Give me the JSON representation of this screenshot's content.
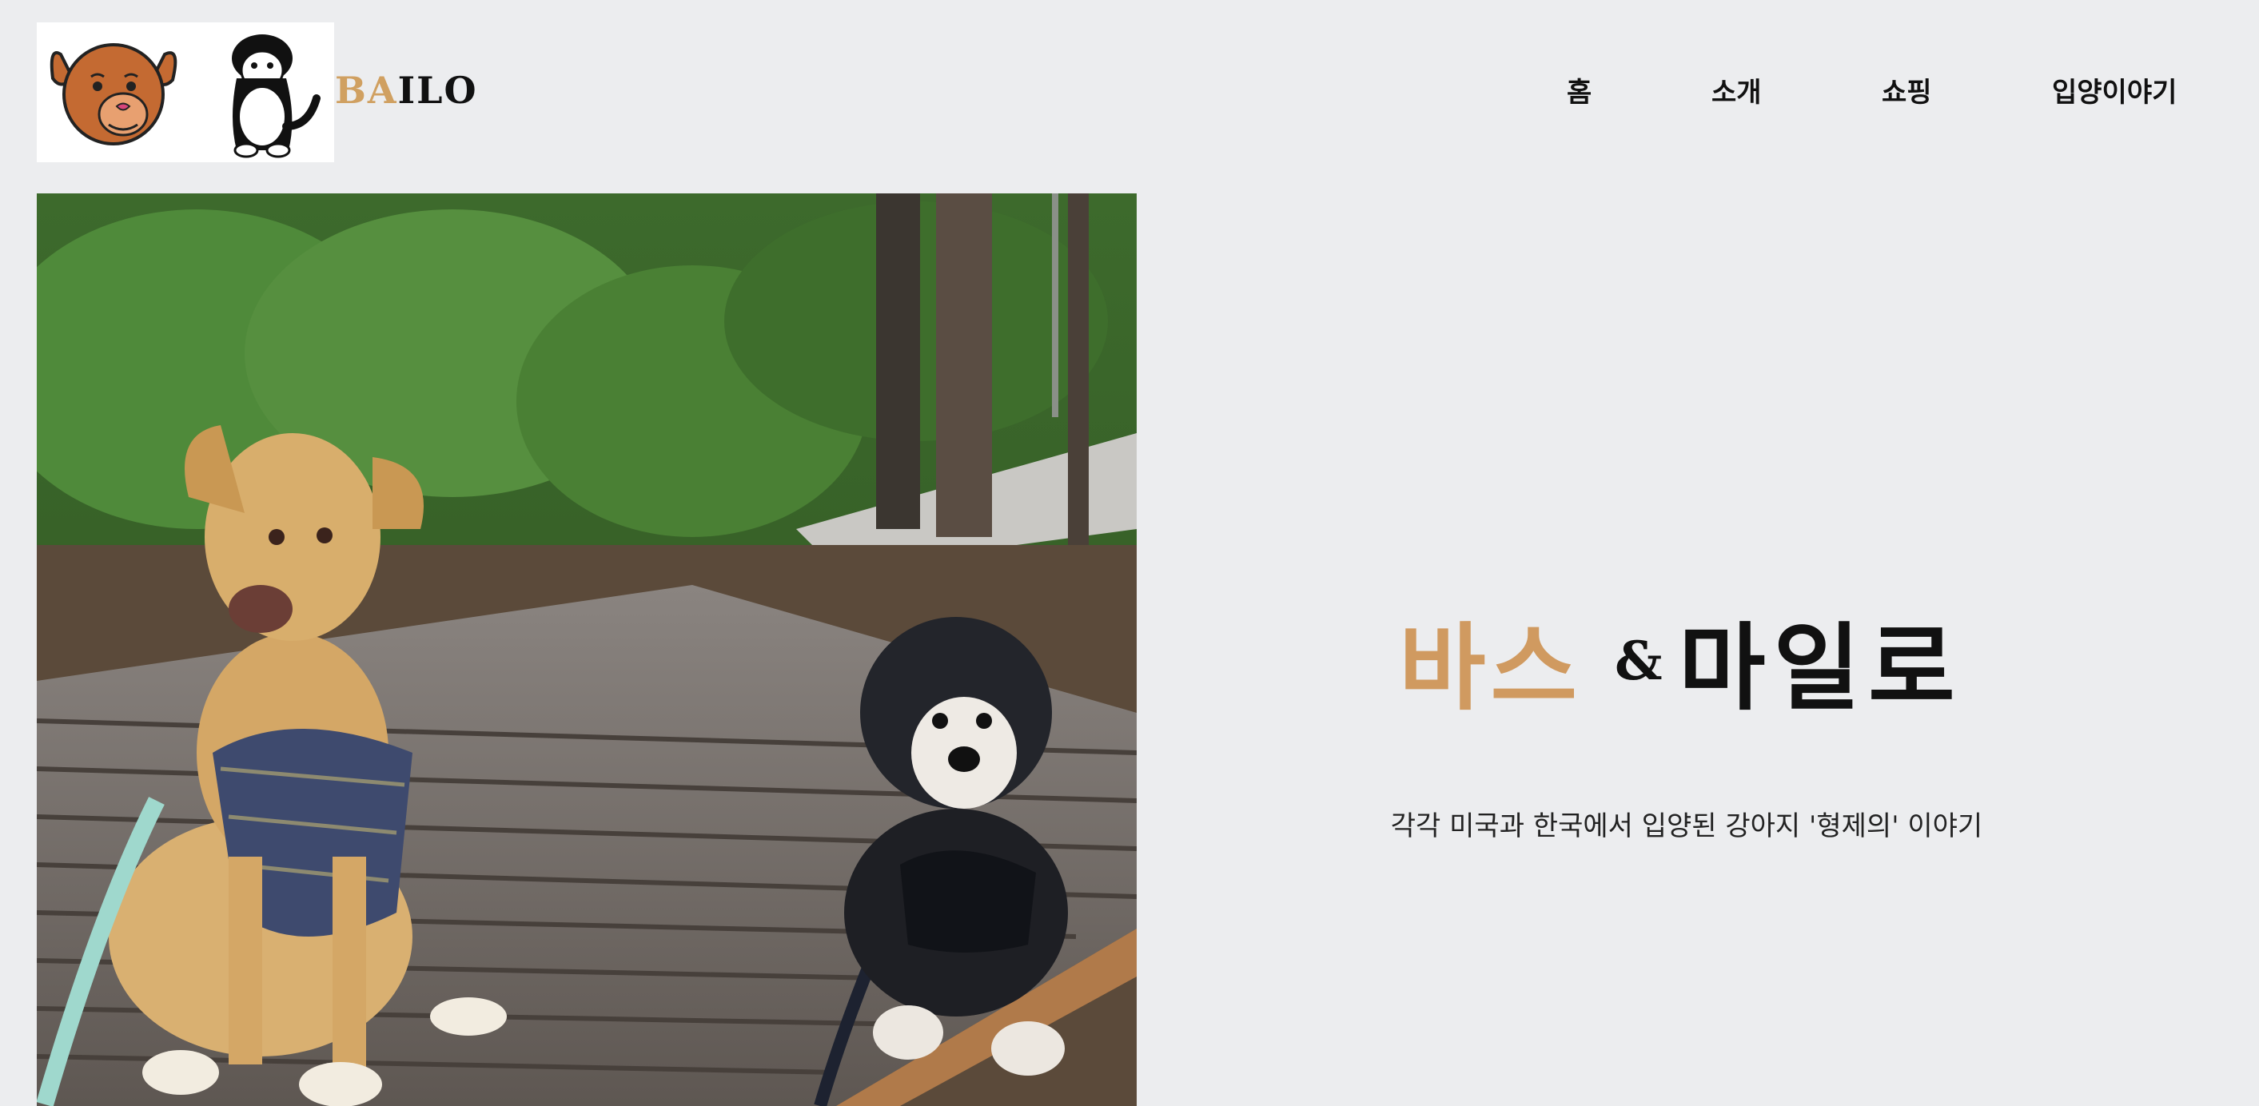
{
  "header": {
    "logo": {
      "text_accent": "BA",
      "text_rest": "ILO",
      "images": [
        "brown-dog-cartoon",
        "black-white-dog-cartoon"
      ]
    },
    "nav": [
      {
        "label": "홈"
      },
      {
        "label": "소개"
      },
      {
        "label": "쇼핑"
      },
      {
        "label": "입양이야기"
      }
    ]
  },
  "hero": {
    "photo_alt": "two dogs on wooden deck",
    "title_name1": "바스",
    "title_amp": "&",
    "title_name2": "마일로",
    "subtitle": "각각 미국과 한국에서 입양된 강아지 '형제의' 이야기"
  },
  "colors": {
    "background": "#ecedef",
    "accent": "#d09a60",
    "text": "#111111"
  }
}
